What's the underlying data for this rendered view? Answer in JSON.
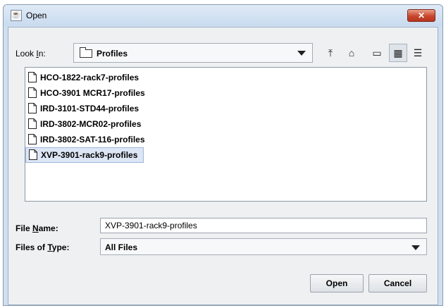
{
  "window": {
    "title": "Open",
    "close_glyph": "✕",
    "title_icon": "java-cup-icon"
  },
  "look_in": {
    "label_prefix": "Look ",
    "label_mnemonic": "I",
    "label_suffix": "n:",
    "value": "Profiles",
    "icon": "folder-icon"
  },
  "toolbar": {
    "buttons": [
      {
        "icon": "up-one-level-icon",
        "glyph": "⤒"
      },
      {
        "icon": "home-icon",
        "glyph": "⌂"
      },
      {
        "icon": "new-folder-icon",
        "glyph": "▭"
      },
      {
        "icon": "list-view-icon",
        "glyph": "▦"
      },
      {
        "icon": "details-view-icon",
        "glyph": "☰"
      }
    ]
  },
  "files": [
    {
      "name": "HCO-1822-rack7-profiles",
      "selected": false
    },
    {
      "name": "HCO-3901 MCR17-profiles",
      "selected": false
    },
    {
      "name": "IRD-3101-STD44-profiles",
      "selected": false
    },
    {
      "name": "IRD-3802-MCR02-profiles",
      "selected": false
    },
    {
      "name": "IRD-3802-SAT-116-profiles",
      "selected": false
    },
    {
      "name": "XVP-3901-rack9-profiles",
      "selected": true
    }
  ],
  "file_name": {
    "label_prefix": "File ",
    "label_mnemonic": "N",
    "label_suffix": "ame:",
    "value": "XVP-3901-rack9-profiles"
  },
  "file_type": {
    "label_prefix": "Files of ",
    "label_mnemonic": "T",
    "label_suffix": "ype:",
    "value": "All Files"
  },
  "buttons": {
    "open": "Open",
    "cancel": "Cancel"
  }
}
